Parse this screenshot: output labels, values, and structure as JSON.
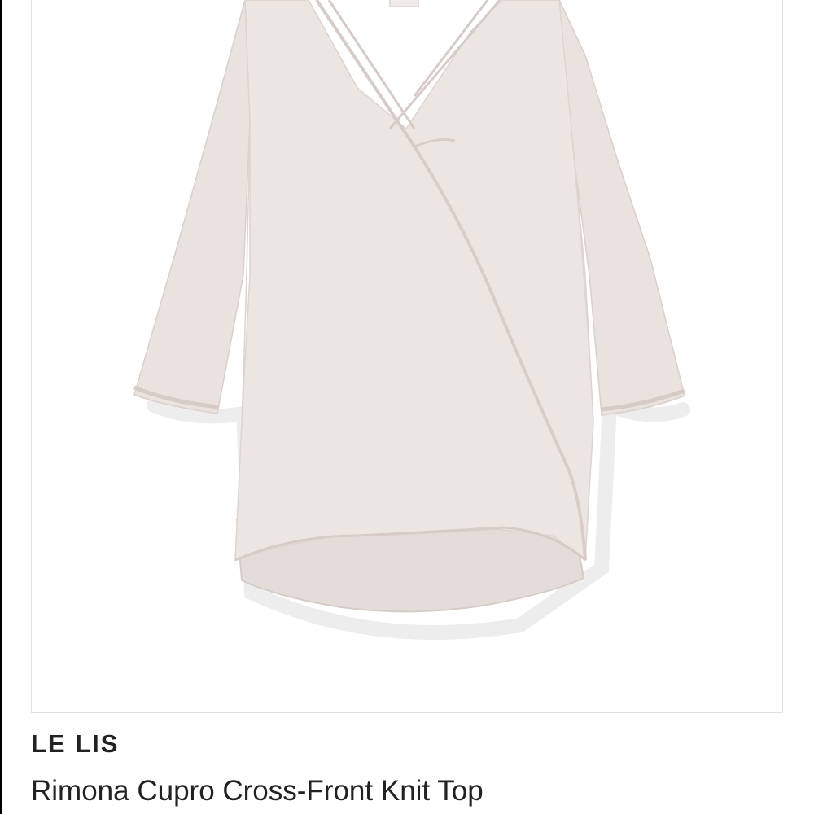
{
  "product": {
    "brand": "LE LIS",
    "name": "Rimona Cupro Cross-Front Knit Top",
    "image_subject": "garment-image",
    "garment_color": "#ece6e3"
  }
}
